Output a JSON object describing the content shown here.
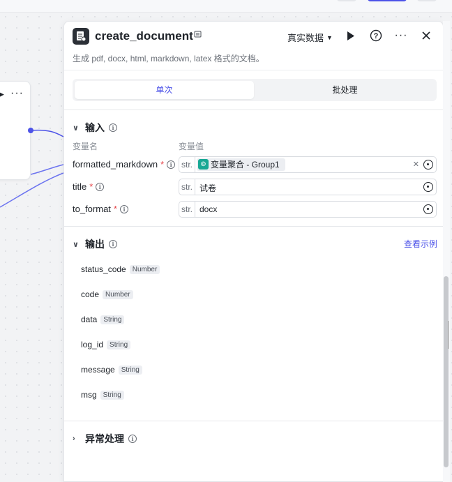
{
  "node": {
    "title": "create_document",
    "description": "生成 pdf, docx, html, markdown, latex 格式的文档。",
    "mode_label": "真实数据",
    "icons": [
      "document-app-icon",
      "bookmark-icon",
      "run-icon",
      "help-icon",
      "more-icon",
      "close-icon"
    ]
  },
  "tabs": [
    {
      "label": "单次",
      "active": true
    },
    {
      "label": "批处理",
      "active": false
    }
  ],
  "inputs": {
    "section_title": "输入",
    "col_name": "变量名",
    "col_value": "变量值",
    "params": [
      {
        "name": "formatted_markdown",
        "required": true,
        "type": "str.",
        "value": "变量聚合 - Group1",
        "is_reference": true
      },
      {
        "name": "title",
        "required": true,
        "type": "str.",
        "value": "试卷",
        "is_reference": false
      },
      {
        "name": "to_format",
        "required": true,
        "type": "str.",
        "value": "docx",
        "is_reference": false
      }
    ]
  },
  "outputs": {
    "section_title": "输出",
    "example_link": "查看示例",
    "fields": [
      {
        "name": "status_code",
        "type": "Number"
      },
      {
        "name": "code",
        "type": "Number"
      },
      {
        "name": "data",
        "type": "String"
      },
      {
        "name": "log_id",
        "type": "String"
      },
      {
        "name": "message",
        "type": "String"
      },
      {
        "name": "msg",
        "type": "String"
      }
    ]
  },
  "exception": {
    "section_title": "异常处理"
  },
  "colors": {
    "accent": "#4d53e8",
    "required": "#e5484d",
    "reference_chip": "#17a894"
  }
}
